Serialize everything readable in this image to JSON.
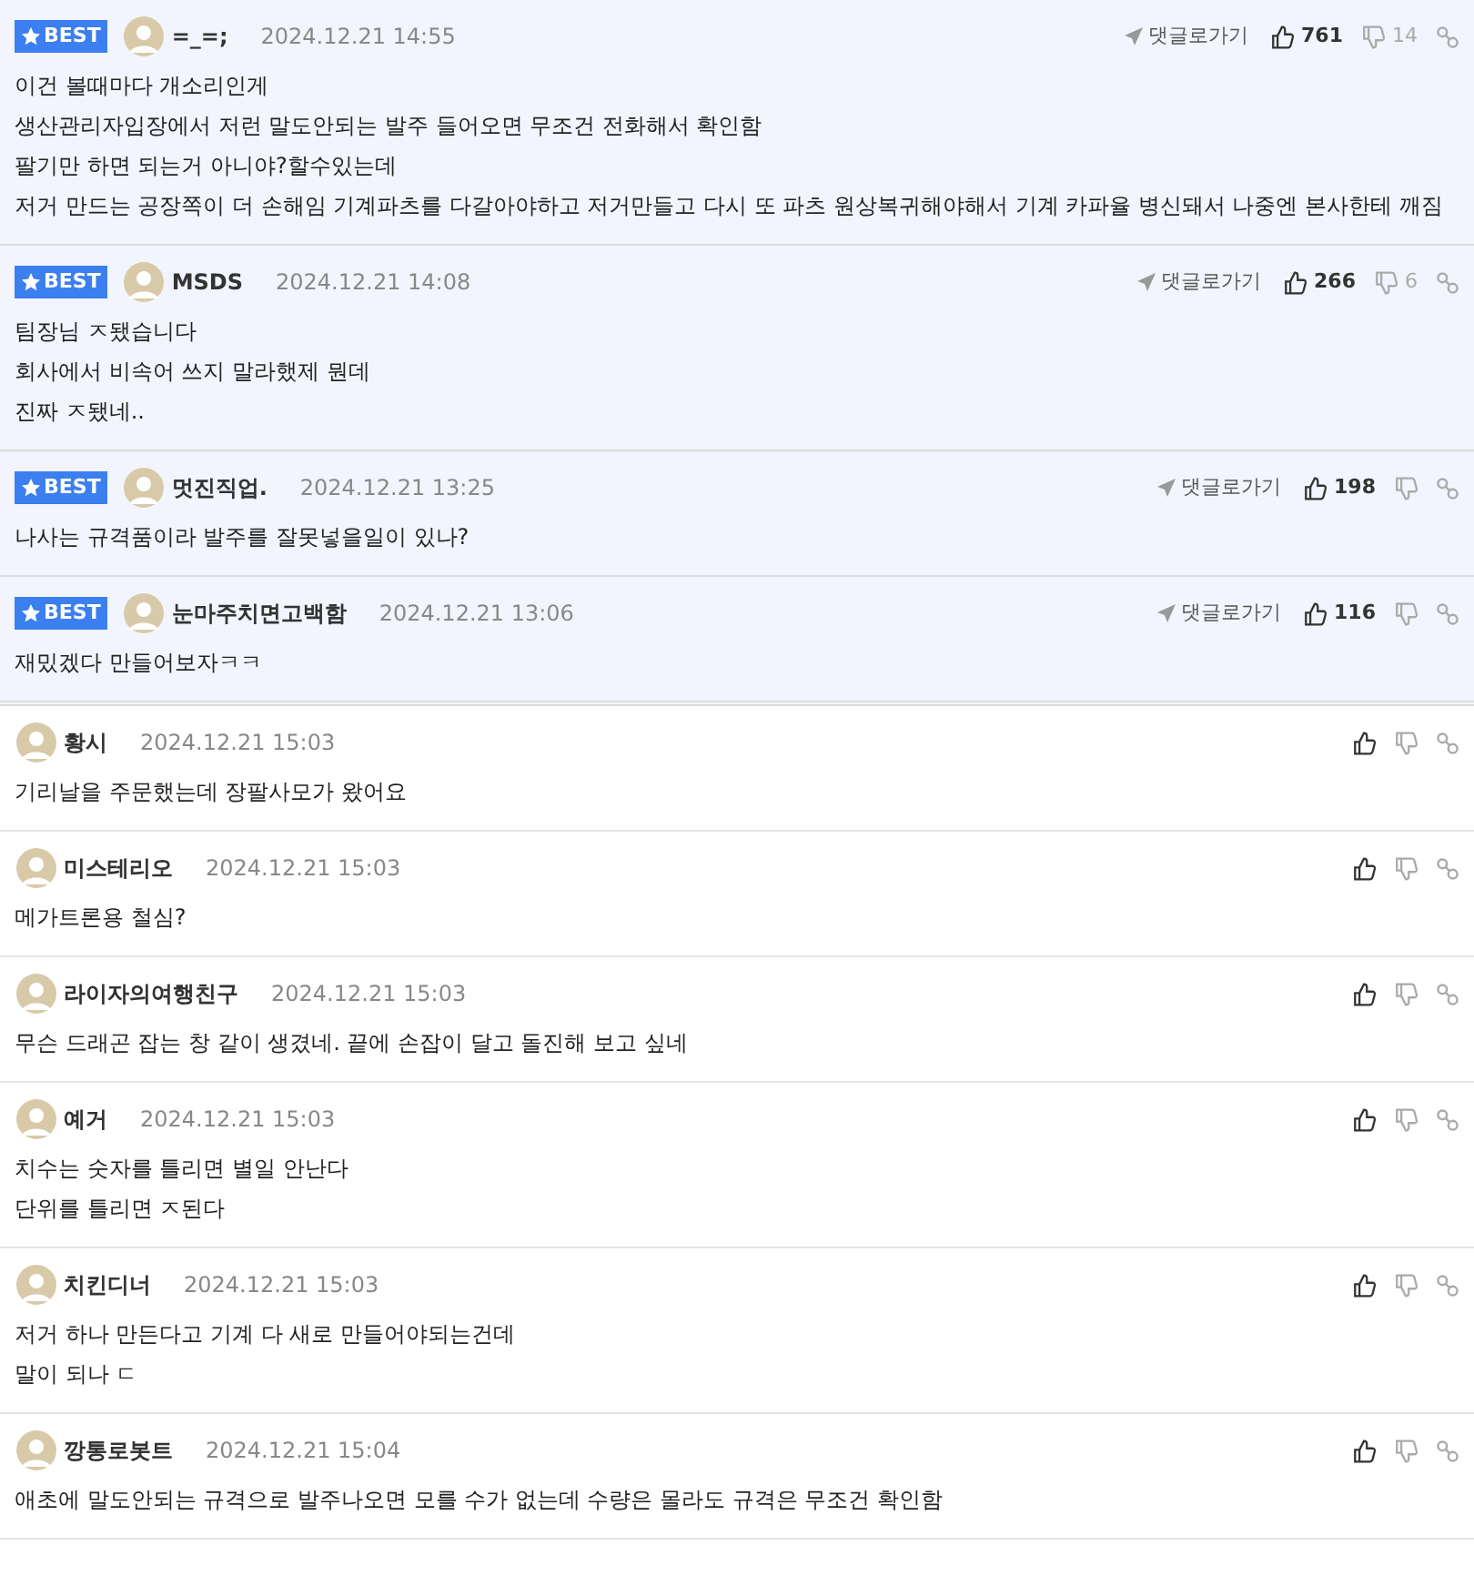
{
  "comments": [
    {
      "best": true,
      "badge": "BEST",
      "author": "=_=;",
      "date": "2024.12.21 14:55",
      "reply_link": "댓글로가기",
      "likes": "761",
      "dislikes": "14",
      "lines": [
        "이건 볼때마다 개소리인게",
        "생산관리자입장에서 저런 말도안되는 발주 들어오면 무조건 전화해서 확인함",
        "팔기만 하면 되는거 아니야?할수있는데",
        "저거 만드는 공장쪽이 더 손해임 기계파츠를 다갈아야하고 저거만들고 다시 또 파츠 원상복귀해야해서 기계 카파율 병신돼서 나중엔 본사한테 깨짐"
      ]
    },
    {
      "best": true,
      "badge": "BEST",
      "author": "MSDS",
      "date": "2024.12.21 14:08",
      "reply_link": "댓글로가기",
      "likes": "266",
      "dislikes": "6",
      "lines": [
        "팀장님 ㅈ됐습니다",
        "회사에서 비속어 쓰지 말라했제 뭔데",
        "진짜 ㅈ됐네.."
      ]
    },
    {
      "best": true,
      "badge": "BEST",
      "author": "멋진직업.",
      "date": "2024.12.21 13:25",
      "reply_link": "댓글로가기",
      "likes": "198",
      "lines": [
        "나사는 규격품이라 발주를 잘못넣을일이 있나?"
      ]
    },
    {
      "best": true,
      "badge": "BEST",
      "author": "눈마주치면고백함",
      "date": "2024.12.21 13:06",
      "reply_link": "댓글로가기",
      "likes": "116",
      "lines": [
        "재밌겠다 만들어보자ㅋㅋ"
      ]
    },
    {
      "best": false,
      "author": "황시",
      "date": "2024.12.21 15:03",
      "lines": [
        "기리날을 주문했는데 장팔사모가 왔어요"
      ]
    },
    {
      "best": false,
      "author": "미스테리오",
      "date": "2024.12.21 15:03",
      "lines": [
        "메가트론용 철심?"
      ]
    },
    {
      "best": false,
      "author": "라이자의여행친구",
      "date": "2024.12.21 15:03",
      "lines": [
        "무슨 드래곤 잡는 창 같이 생겼네. 끝에 손잡이 달고 돌진해 보고 싶네"
      ]
    },
    {
      "best": false,
      "author": "예거",
      "date": "2024.12.21 15:03",
      "lines": [
        "치수는 숫자를 틀리면 별일 안난다",
        "단위를 틀리면 ㅈ된다"
      ]
    },
    {
      "best": false,
      "author": "치킨디너",
      "date": "2024.12.21 15:03",
      "lines": [
        "저거 하나 만든다고 기계 다 새로 만들어야되는건데",
        "말이 되나 ㄷ"
      ]
    },
    {
      "best": false,
      "author": "깡통로봇트",
      "date": "2024.12.21 15:04",
      "lines": [
        "애초에 말도안되는 규격으로 발주나오면 모를 수가 없는데 수량은 몰라도 규격은 무조건 확인함"
      ]
    }
  ]
}
